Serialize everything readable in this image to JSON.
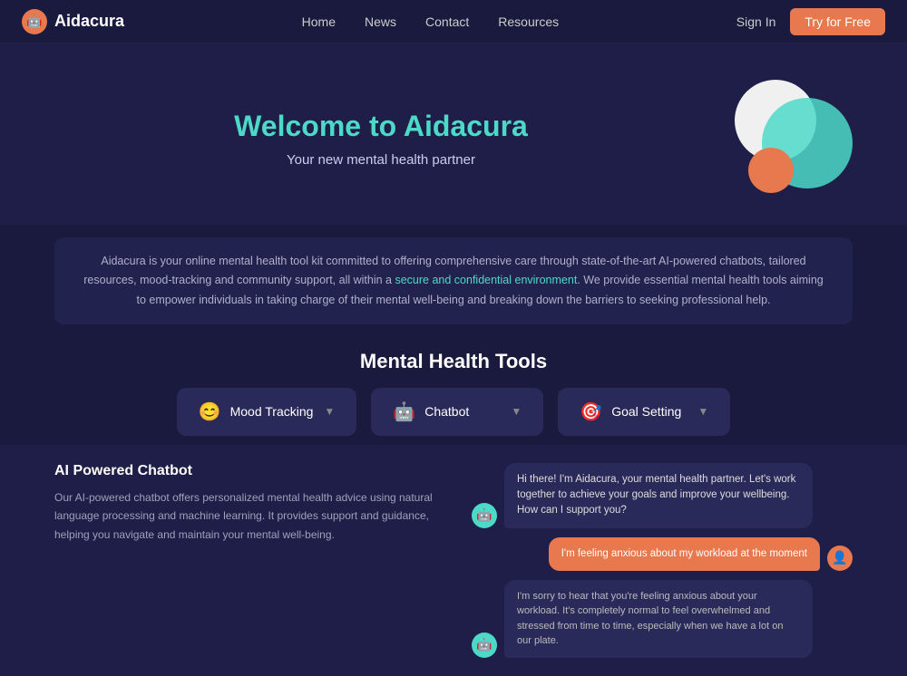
{
  "nav": {
    "logo_text": "Aidacura",
    "logo_icon": "🤖",
    "links": [
      "Home",
      "News",
      "Contact",
      "Resources"
    ],
    "signin_label": "Sign In",
    "try_label": "Try for Free"
  },
  "hero": {
    "title_prefix": "Welcome to Aida",
    "title_accent": "cura",
    "subtitle": "Your new mental health partner"
  },
  "description": {
    "text_before_link": "Aidacura is your online mental health tool kit committed to offering comprehensive care through state-of-the-art AI-powered chatbots, tailored resources, mood-tracking and community support, all within a ",
    "link_text": "secure and confidential environment",
    "text_after_link": ". We provide essential mental health tools aiming to empower individuals in taking charge of their mental well-being and breaking down the barriers to seeking professional help."
  },
  "tools": {
    "section_title": "Mental Health Tools",
    "cards": [
      {
        "icon": "😊",
        "label": "Mood Tracking"
      },
      {
        "icon": "🤖",
        "label": "Chatbot"
      },
      {
        "icon": "🎯",
        "label": "Goal Setting"
      }
    ]
  },
  "chatbot": {
    "title": "AI Powered Chatbot",
    "description": "Our AI-powered chatbot offers personalized mental health advice using natural language processing and machine learning. It provides support and guidance, helping you navigate and maintain your mental well-being.",
    "messages": [
      {
        "type": "bot",
        "text": "Hi there! I'm Aidacura, your mental health partner. Let's work together to achieve your goals and improve your wellbeing. How can I support you?"
      },
      {
        "type": "user",
        "text": "I'm feeling anxious about my workload at the moment"
      },
      {
        "type": "bot",
        "text": "I'm sorry to hear that you're feeling anxious about your workload. It's completely normal to feel overwhelmed and stressed from time to time, especially when we have a lot on our plate."
      }
    ]
  }
}
